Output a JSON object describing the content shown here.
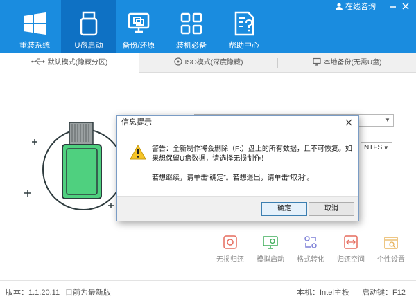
{
  "header": {
    "nav": [
      {
        "label": "重装系统",
        "icon": "windows-logo-icon"
      },
      {
        "label": "U盘启动",
        "icon": "usb-drive-icon"
      },
      {
        "label": "备份/还原",
        "icon": "backup-restore-icon"
      },
      {
        "label": "装机必备",
        "icon": "apps-grid-icon"
      },
      {
        "label": "帮助中心",
        "icon": "help-document-icon"
      }
    ],
    "active_index": 1,
    "consult_label": "在线咨询",
    "accent_color": "#1a8cdf",
    "active_color": "#0e71c4"
  },
  "tabs": [
    {
      "label": "默认模式(隐藏分区)",
      "icon": "usb-symbol-icon"
    },
    {
      "label": "ISO模式(深度隐藏)",
      "icon": "disc-icon"
    },
    {
      "label": "本地备份(无需U盘)",
      "icon": "monitor-icon"
    }
  ],
  "main": {
    "format_value": "NTFS",
    "tools": [
      {
        "label": "无损归还",
        "icon": "lossless-return-icon",
        "color": "#e56b5d"
      },
      {
        "label": "模拟启动",
        "icon": "simulate-boot-icon",
        "color": "#3fae5a"
      },
      {
        "label": "格式转化",
        "icon": "format-convert-icon",
        "color": "#7b7fd6"
      },
      {
        "label": "归还空间",
        "icon": "return-space-icon",
        "color": "#e56b5d"
      },
      {
        "label": "个性设置",
        "icon": "personal-settings-icon",
        "color": "#e8b35a"
      }
    ]
  },
  "footer": {
    "version": "版本：1.1.20.11",
    "status": "目前为最新版",
    "machine": "本机：Intel主板",
    "hotkey": "启动键：F12"
  },
  "dialog": {
    "title": "信息提示",
    "message1": "警告：全新制作将会删除（F:）盘上的所有数据，且不可恢复。如果想保留U盘数据，请选择无损制作！",
    "message2": "若想继续，请单击“确定”。若想退出，请单击“取消”。",
    "ok_label": "确定",
    "cancel_label": "取消"
  }
}
